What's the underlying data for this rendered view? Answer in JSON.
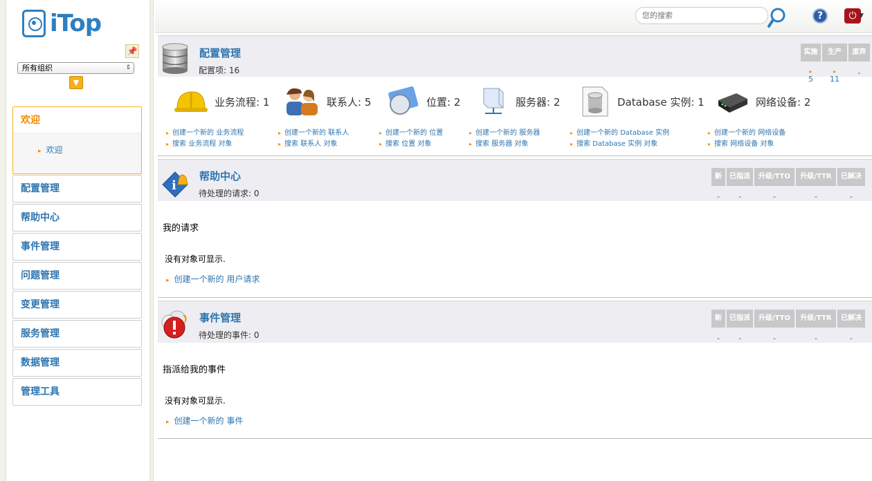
{
  "org_selector": {
    "value": "所有组织"
  },
  "menu": {
    "welcome": {
      "title": "欢迎",
      "sub_item": "欢迎"
    },
    "groups": [
      "配置管理",
      "帮助中心",
      "事件管理",
      "问题管理",
      "变更管理",
      "服务管理",
      "数据管理",
      "管理工具"
    ]
  },
  "top_bar": {
    "search_placeholder": "您的搜索"
  },
  "config": {
    "title": "配置管理",
    "subtitle": "配置项: 16",
    "status_headers": [
      "实施",
      "生产",
      "废弃"
    ],
    "status_values": [
      "5",
      "11",
      "-"
    ],
    "items": [
      {
        "label": "业务流程: 1",
        "create": "创建一个新的 业务流程",
        "search": "搜索 业务流程 对象",
        "icon": "helmet-icon"
      },
      {
        "label": "联系人: 5",
        "create": "创建一个新的 联系人",
        "search": "搜索 联系人 对象",
        "icon": "contacts-icon"
      },
      {
        "label": "位置: 2",
        "create": "创建一个新的 位置",
        "search": "搜索 位置 对象",
        "icon": "compass-icon"
      },
      {
        "label": "服务器: 2",
        "create": "创建一个新的 服务器",
        "search": "搜索 服务器 对象",
        "icon": "server-icon"
      },
      {
        "label": "Database 实例: 1",
        "create": "创建一个新的 Database 实例",
        "search": "搜索 Database 实例 对象",
        "icon": "database-instance-icon"
      },
      {
        "label": "网络设备: 2",
        "create": "创建一个新的 网络设备",
        "search": "搜索 网络设备 对象",
        "icon": "network-device-icon"
      }
    ]
  },
  "helpdesk": {
    "title": "帮助中心",
    "subtitle": "待处理的请求: 0",
    "status_headers": [
      "新",
      "已指派",
      "升级/TTO",
      "升级/TTR",
      "已解决"
    ],
    "status_values": [
      "-",
      "-",
      "-",
      "-",
      "-"
    ],
    "section_label": "我的请求",
    "empty_text": "没有对象可显示.",
    "create_link": "创建一个新的 用户请求"
  },
  "incidents": {
    "title": "事件管理",
    "subtitle": "待处理的事件: 0",
    "status_headers": [
      "新",
      "已指派",
      "升级/TTO",
      "升级/TTR",
      "已解决"
    ],
    "status_values": [
      "-",
      "-",
      "-",
      "-",
      "-"
    ],
    "section_label": "指派给我的事件",
    "empty_text": "没有对象可显示.",
    "create_link": "创建一个新的 事件"
  },
  "colors": {
    "link_blue": "#2d75b0",
    "accent_orange": "#f08c00",
    "header_gray": "#eeeef2"
  }
}
